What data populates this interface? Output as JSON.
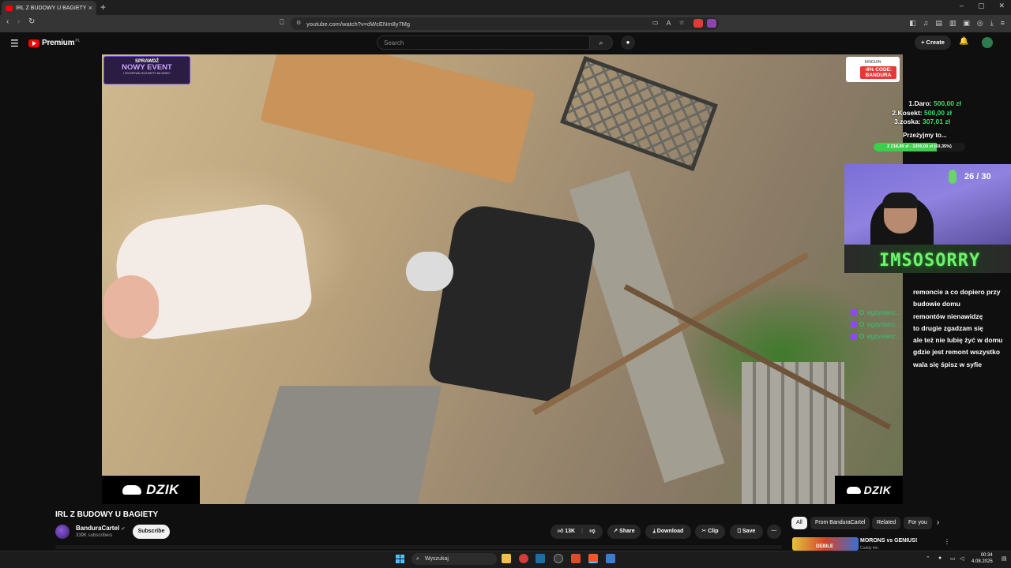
{
  "browser": {
    "tab_title": "IRL Z BUDOWY U BAGIETY - Y",
    "tab_close": "×",
    "new_tab": "+",
    "window_controls": [
      "–",
      "▢",
      "✕"
    ],
    "url": "youtube.com/watch?v=dWcENm8y7Mg"
  },
  "youtube": {
    "logo_text": "Premium",
    "logo_country": "PL",
    "search_placeholder": "Search",
    "create_label": "+ Create"
  },
  "overlay": {
    "event_line1": "SPRAWDŹ",
    "event_line2": "NOWY EVENT",
    "event_line3": "I WYGRYWAJ KLEJNOTY NA SKINY!",
    "promo_brand": "KINGUIN",
    "promo_code": "-8% CODE: BANDURA",
    "donors": [
      {
        "rank": "1.",
        "name": "Daro:",
        "amount": "500,00 zł"
      },
      {
        "rank": "2.",
        "name": "Kosekt:",
        "amount": "500,00 zł"
      },
      {
        "rank": "3.",
        "name": "zoska:",
        "amount": "307,01 zł"
      }
    ],
    "goal_title": "Przeżyjmy to...",
    "goal_text": "2 218,89 zł - 3200,00 zł (69,35%)",
    "goal_fraction": 0.6935,
    "counter": "26 / 30",
    "webcam_banner": "IMSOSORRY",
    "chat_user": "egzystenc...",
    "chat_lines": [
      "remoncie a co dopiero przy",
      "budowie domu",
      "remontów nienawidzę",
      "to drugie zgadzam się",
      "ale też nie lubię żyć w domu",
      "gdzie jest remont wszystko",
      "wala się śpisz w syfie"
    ],
    "watermark": "DZIK"
  },
  "video_info": {
    "title": "IRL Z BUDOWY U BAGIETY",
    "channel": "BanduraCartel",
    "verified": "✔",
    "subscribers": "339K subscribers",
    "subscribe_label": "Subscribe",
    "likes": "13K",
    "share_label": "Share",
    "download_label": "Download",
    "clip_label": "Clip",
    "save_label": "Save",
    "more_label": "···"
  },
  "sidebar": {
    "chips": [
      "All",
      "From BanduraCartel",
      "Related",
      "For you"
    ],
    "rec_title": "MORONS vs GENIUS!",
    "rec_channel": "Cuddy 4m",
    "rec_thumb_text": "DEBILE"
  },
  "taskbar": {
    "search_label": "Wyszukaj",
    "time": "00:34",
    "date": "4.08.2025"
  }
}
